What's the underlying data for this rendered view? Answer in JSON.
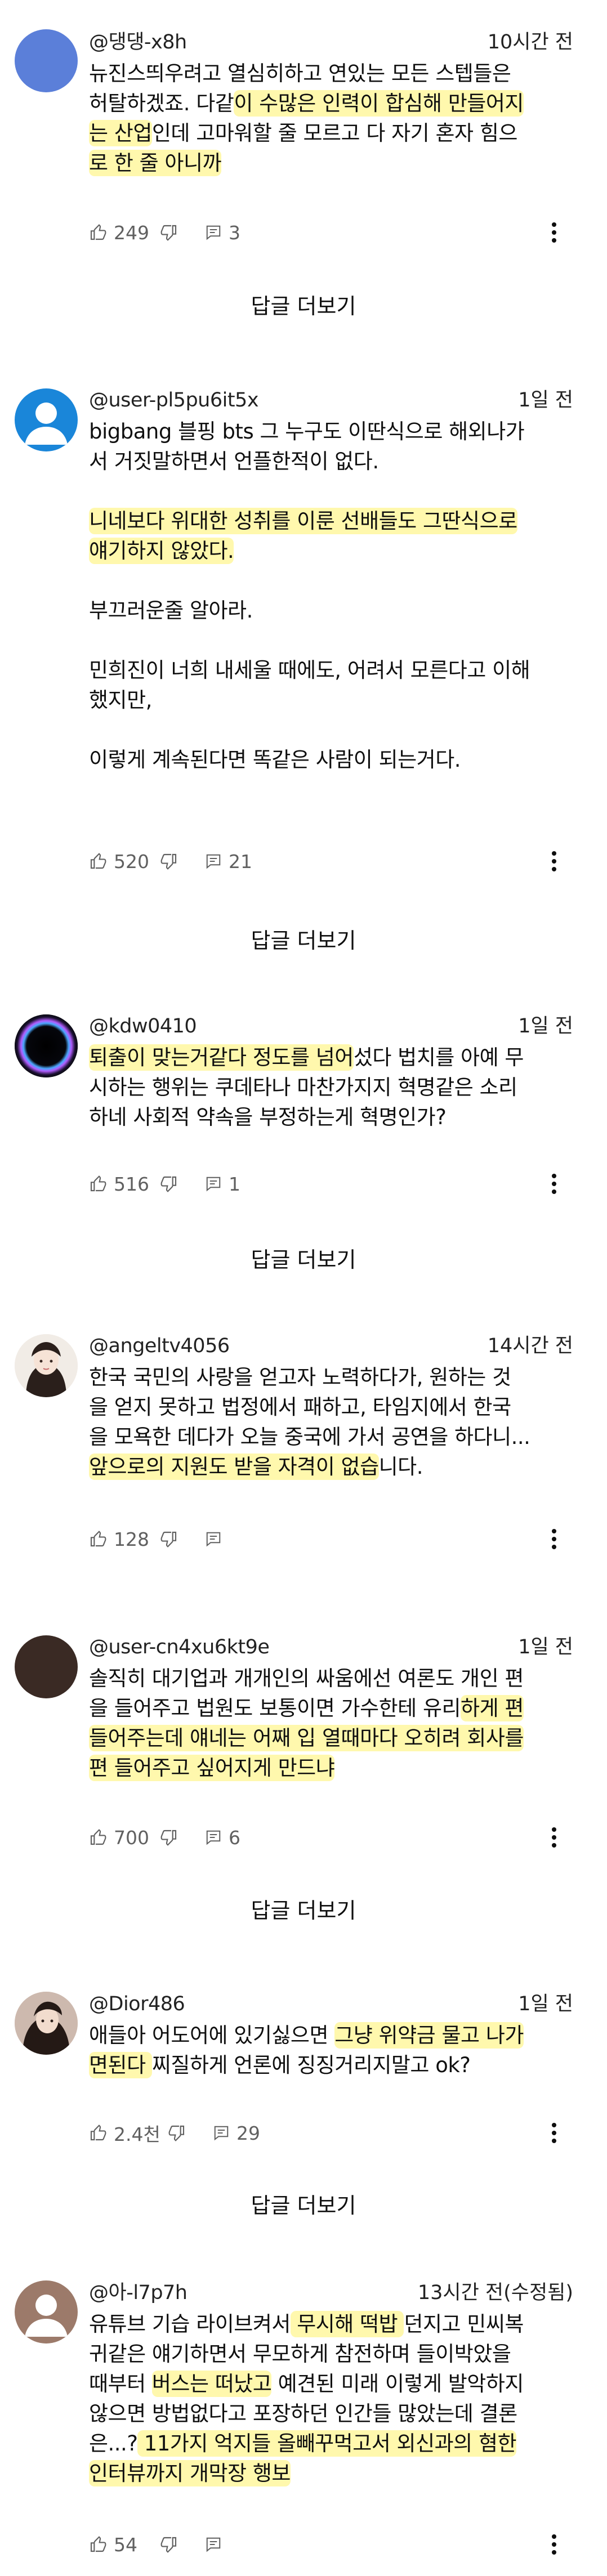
{
  "comments": [
    {
      "username": "@댕댕-x8h",
      "time": "10시간 전",
      "likes": "249",
      "replies": "3",
      "show_replies": "답글 더보기",
      "avatar_color": "#5b7fd9",
      "lines": [
        "뉴진스띄우려고 열심히하고 연있는 모든 스텝들은",
        "허탈하겠죠. 다같이 수많은 인력이 합심해 만들어지",
        "는 산업인데 고마워할 줄 모르고 다 자기 혼자 힘으",
        "로 한 줄 아니까"
      ]
    },
    {
      "username": "@user-pl5pu6it5x",
      "time": "1일 전",
      "likes": "520",
      "replies": "21",
      "show_replies": "답글 더보기",
      "avatar_color": "#1a86d9",
      "p1": [
        "bigbang 블핑 bts 그 누구도 이딴식으로 해외나가",
        "서 거짓말하면서 언플한적이 없다."
      ],
      "p2": [
        "니네보다 위대한 성취를 이룬 선배들도 그딴식으로",
        "얘기하지 않았다."
      ],
      "p3": [
        "부끄러운줄 알아라."
      ],
      "p4": [
        "민희진이 너희 내세울 때에도, 어려서 모른다고 이해",
        "했지만,"
      ],
      "p5": [
        "이렇게 계속된다면 똑같은 사람이 되는거다."
      ]
    },
    {
      "username": "@kdw0410",
      "time": "1일 전",
      "likes": "516",
      "replies": "1",
      "show_replies": "답글 더보기",
      "lines": [
        "퇴출이 맞는거같다 정도를 넘어섰다 법치를 아예 무",
        "시하는 행위는 쿠데타나 마찬가지지 혁명같은 소리",
        "하네 사회적 약속을 부정하는게 혁명인가?"
      ]
    },
    {
      "username": "@angeltv4056",
      "time": "14시간 전",
      "likes": "128",
      "lines": [
        "한국 국민의 사랑을 얻고자 노력하다가, 원하는 것",
        "을 얻지 못하고 법정에서 패하고, 타임지에서 한국",
        "을 모욕한 데다가 오늘 중국에 가서 공연을 하다니...",
        "앞으로의 지원도 받을 자격이 없습니다."
      ]
    },
    {
      "username": "@user-cn4xu6kt9e",
      "time": "1일 전",
      "likes": "700",
      "replies": "6",
      "show_replies": "답글 더보기",
      "avatar_color": "#3a2a24",
      "lines": [
        "솔직히 대기업과 개개인의 싸움에선 여론도 개인 편",
        "을 들어주고 법원도 보통이면 가수한테 유리하게 편",
        "들어주는데 얘네는 어째 입 열때마다 오히려 회사를",
        "편 들어주고 싶어지게 만드냐"
      ]
    },
    {
      "username": "@Dior486",
      "time": "1일 전",
      "likes": "2.4천",
      "replies": "29",
      "show_replies": "답글 더보기",
      "lines": [
        "애들아 어도어에 있기싫으면 그냥 위약금 물고 나가",
        "면된다 찌질하게 언론에 징징거리지말고 ok?"
      ]
    },
    {
      "username": "@아-l7p7h",
      "time": "13시간 전(수정됨)",
      "likes": "54",
      "avatar_color": "#9c7a6a",
      "lines": [
        "유튜브 기습 라이브켜서 무시해 떡밥 던지고 민씨복",
        "귀같은 얘기하면서 무모하게 참전하며 들이박았을",
        "때부터 버스는 떠났고 예견된 미래 이렇게 발악하지",
        "않으면 방법없다고 포장하던 인간들 많았는데 결론",
        "은...? 11가지 억지들 올빼꾸먹고서 외신과의 혐한",
        "인터뷰까지 개막장 행보"
      ]
    }
  ]
}
